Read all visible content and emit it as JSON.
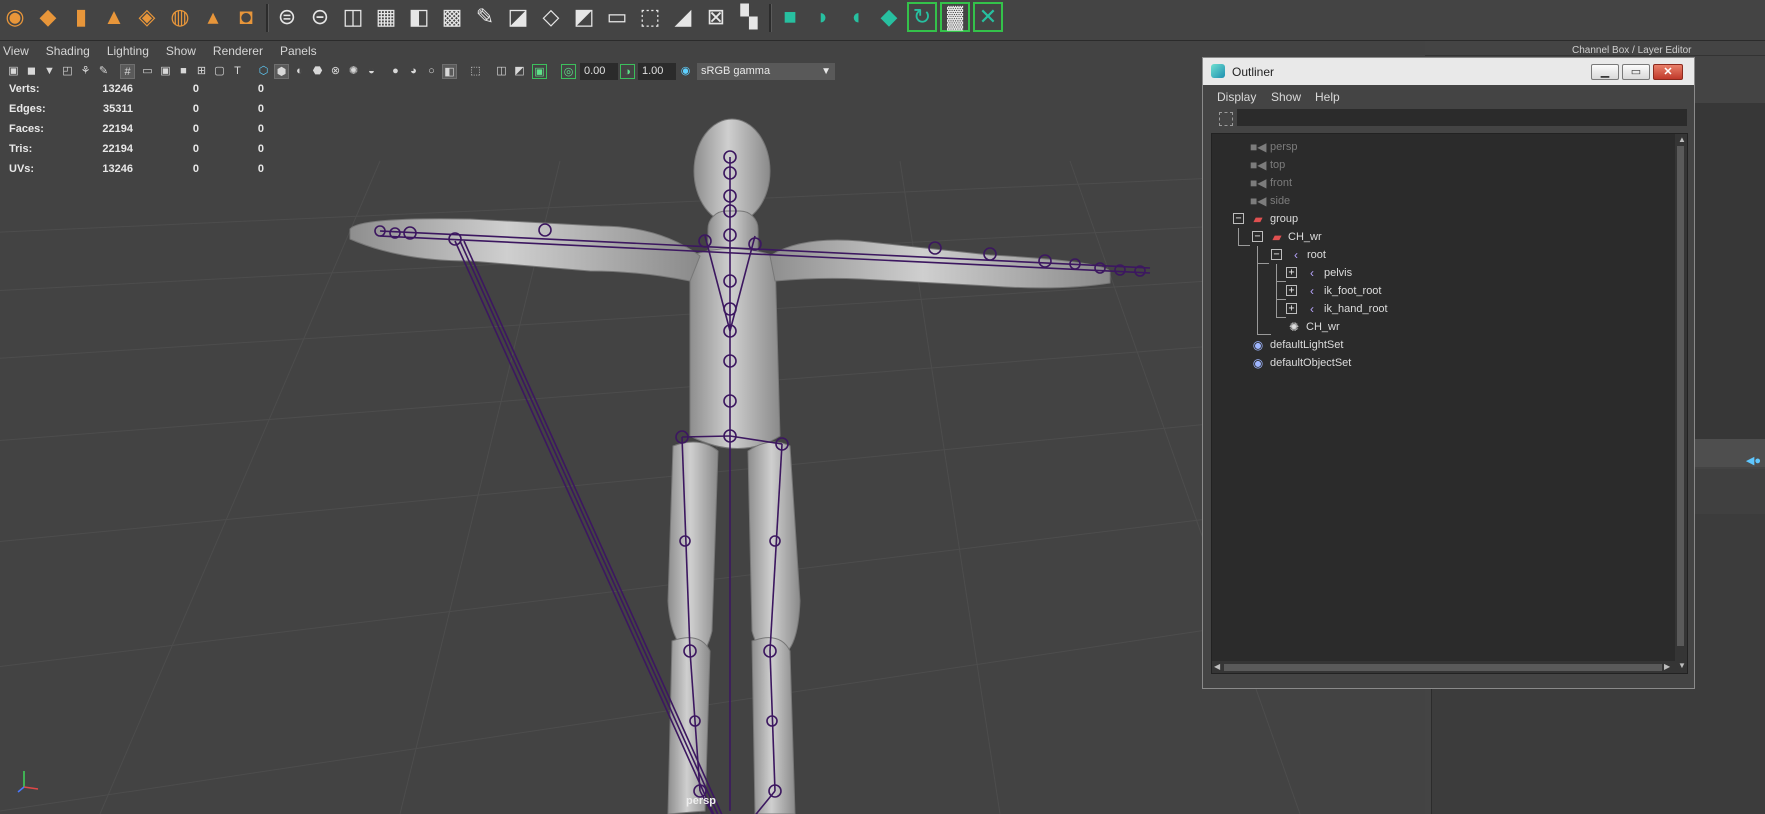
{
  "shelf": {
    "icons": [
      {
        "name": "poly-sphere-icon",
        "glyph": "◉",
        "style": "orange"
      },
      {
        "name": "poly-cube-icon",
        "glyph": "◆",
        "style": "orange"
      },
      {
        "name": "poly-cylinder-icon",
        "glyph": "▮",
        "style": "orange"
      },
      {
        "name": "poly-cone-icon",
        "glyph": "▲",
        "style": "orange"
      },
      {
        "name": "poly-plane-icon",
        "glyph": "◈",
        "style": "orange"
      },
      {
        "name": "poly-torus-icon",
        "glyph": "◍",
        "style": "orange"
      },
      {
        "name": "poly-pyramid-icon",
        "glyph": "▴",
        "style": "orange"
      },
      {
        "name": "poly-pipe-icon",
        "glyph": "◘",
        "style": "orange"
      },
      {
        "name": "combine-icon",
        "glyph": "⊜",
        "style": "white"
      },
      {
        "name": "separate-icon",
        "glyph": "⊝",
        "style": "white"
      },
      {
        "name": "mirror-icon",
        "glyph": "◫",
        "style": "white"
      },
      {
        "name": "smooth-icon",
        "glyph": "▦",
        "style": "white"
      },
      {
        "name": "extrude-icon",
        "glyph": "◧",
        "style": "white"
      },
      {
        "name": "bridge-icon",
        "glyph": "▩",
        "style": "white"
      },
      {
        "name": "multi-cut-icon",
        "glyph": "✎",
        "style": "white"
      },
      {
        "name": "bevel-icon",
        "glyph": "◪",
        "style": "white"
      },
      {
        "name": "append-polygon-icon",
        "glyph": "◇",
        "style": "white"
      },
      {
        "name": "fill-hole-icon",
        "glyph": "◩",
        "style": "white"
      },
      {
        "name": "offset-edge-icon",
        "glyph": "▭",
        "style": "white"
      },
      {
        "name": "insert-edge-loop-icon",
        "glyph": "⬚",
        "style": "white"
      },
      {
        "name": "target-weld-icon",
        "glyph": "◢",
        "style": "white"
      },
      {
        "name": "merge-icon",
        "glyph": "⊠",
        "style": "white"
      },
      {
        "name": "checker-icon",
        "glyph": "▚",
        "style": "white"
      },
      {
        "name": "uv-planar-icon",
        "glyph": "■",
        "style": "green"
      },
      {
        "name": "uv-cylindrical-icon",
        "glyph": "◗",
        "style": "green"
      },
      {
        "name": "uv-spherical-icon",
        "glyph": "◖",
        "style": "green"
      },
      {
        "name": "uv-auto-icon",
        "glyph": "◆",
        "style": "green"
      },
      {
        "name": "uv-unfold-icon",
        "glyph": "↻",
        "style": "green framed"
      },
      {
        "name": "uv-layout-icon",
        "glyph": "▓",
        "style": "white framed"
      },
      {
        "name": "uv-cut-icon",
        "glyph": "✕",
        "style": "green framed"
      }
    ]
  },
  "viewport": {
    "menu": [
      "View",
      "Shading",
      "Lighting",
      "Show",
      "Renderer",
      "Panels"
    ],
    "exposure": "0.00",
    "gamma": "1.00",
    "color_space": "sRGB gamma",
    "camera_label": "persp",
    "hud": [
      {
        "label": "Verts:",
        "v1": "13246",
        "v2": "0",
        "v3": "0"
      },
      {
        "label": "Edges:",
        "v1": "35311",
        "v2": "0",
        "v3": "0"
      },
      {
        "label": "Faces:",
        "v1": "22194",
        "v2": "0",
        "v3": "0"
      },
      {
        "label": "Tris:",
        "v1": "22194",
        "v2": "0",
        "v3": "0"
      },
      {
        "label": "UVs:",
        "v1": "13246",
        "v2": "0",
        "v3": "0"
      }
    ]
  },
  "right_panel": {
    "title": "Channel Box / Layer Editor"
  },
  "outliner": {
    "title": "Outliner",
    "menu": [
      "Display",
      "Show",
      "Help"
    ],
    "search_value": "",
    "items": [
      {
        "label": "persp",
        "type": "camera",
        "dim": true
      },
      {
        "label": "top",
        "type": "camera",
        "dim": true
      },
      {
        "label": "front",
        "type": "camera",
        "dim": true
      },
      {
        "label": "side",
        "type": "camera",
        "dim": true
      },
      {
        "label": "group",
        "type": "transform",
        "dim": false
      },
      {
        "label": "CH_wr",
        "type": "transform",
        "dim": false
      },
      {
        "label": "root",
        "type": "joint",
        "dim": false
      },
      {
        "label": "pelvis",
        "type": "joint",
        "dim": false
      },
      {
        "label": "ik_foot_root",
        "type": "joint",
        "dim": false
      },
      {
        "label": "ik_hand_root",
        "type": "joint",
        "dim": false
      },
      {
        "label": "CH_wr",
        "type": "mesh",
        "dim": false
      },
      {
        "label": "defaultLightSet",
        "type": "set",
        "dim": false
      },
      {
        "label": "defaultObjectSet",
        "type": "set",
        "dim": false
      }
    ]
  }
}
